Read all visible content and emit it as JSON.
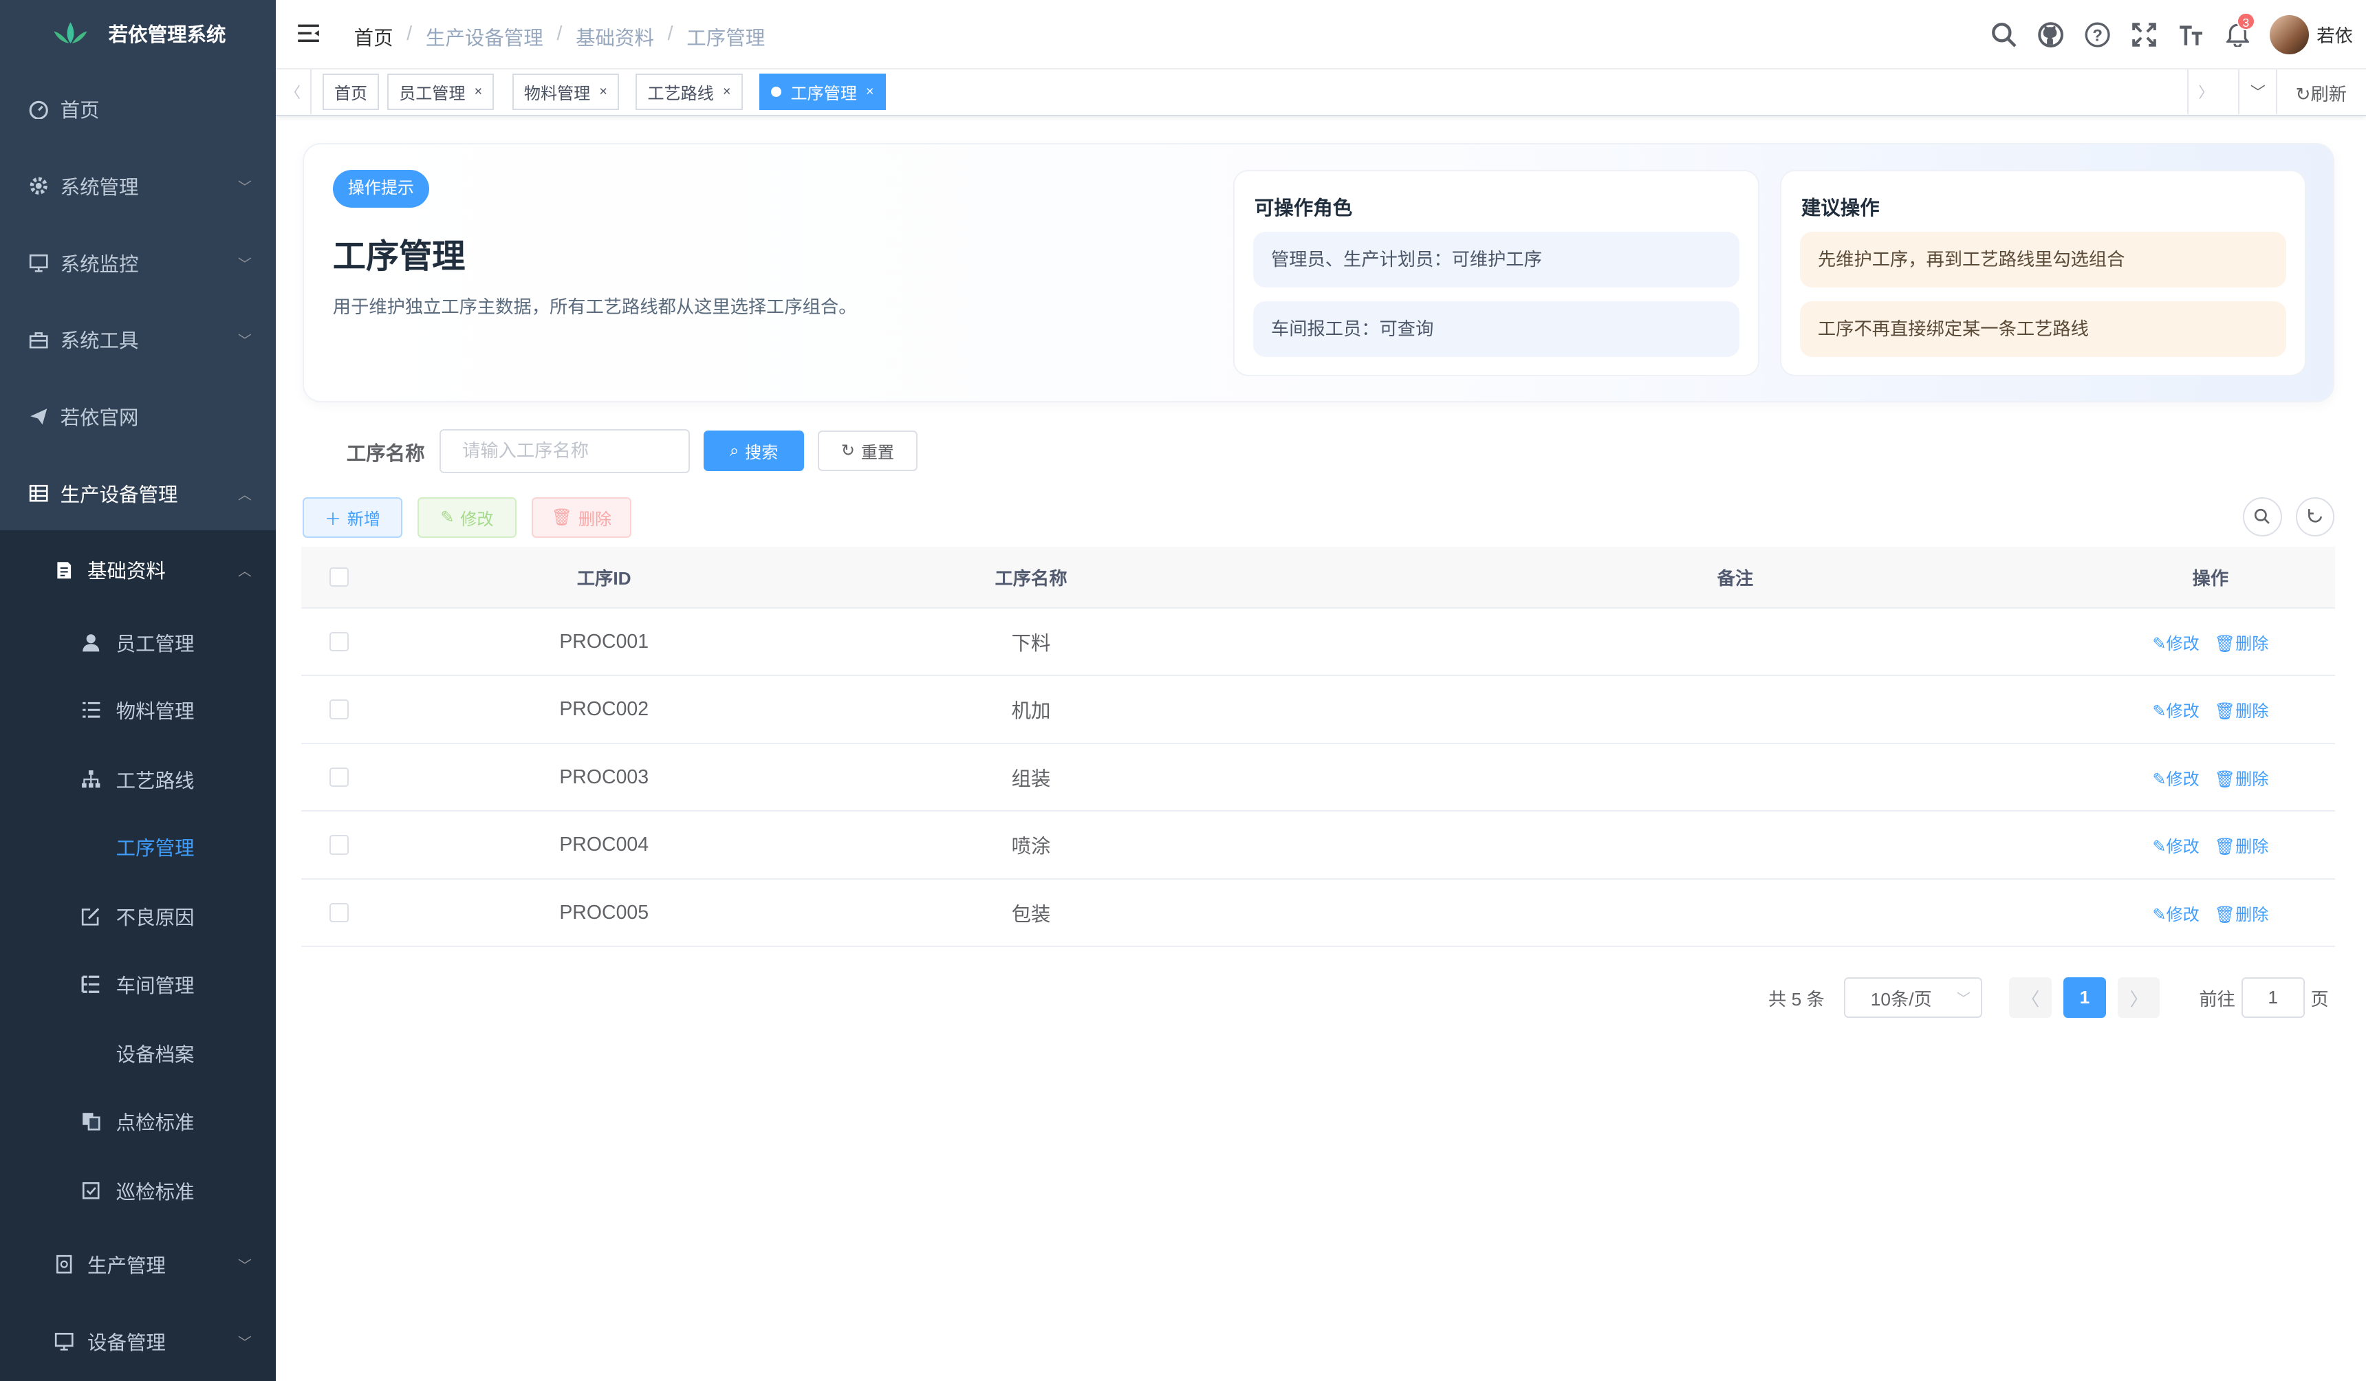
{
  "app": {
    "title": "若依管理系统"
  },
  "sidebar": {
    "items": [
      {
        "label": "首页"
      },
      {
        "label": "系统管理"
      },
      {
        "label": "系统监控"
      },
      {
        "label": "系统工具"
      },
      {
        "label": "若依官网"
      },
      {
        "label": "生产设备管理"
      }
    ],
    "sub": {
      "label": "基础资料"
    },
    "leaf": [
      {
        "label": "员工管理"
      },
      {
        "label": "物料管理"
      },
      {
        "label": "工艺路线"
      },
      {
        "label": "工序管理"
      },
      {
        "label": "不良原因"
      },
      {
        "label": "车间管理"
      },
      {
        "label": "设备档案"
      },
      {
        "label": "点检标准"
      },
      {
        "label": "巡检标准"
      }
    ],
    "tail": [
      {
        "label": "生产管理"
      },
      {
        "label": "设备管理"
      }
    ]
  },
  "breadcrumb": [
    "首页",
    "生产设备管理",
    "基础资料",
    "工序管理"
  ],
  "navbar": {
    "notif_count": "3",
    "username": "若依"
  },
  "tags": [
    {
      "label": "首页"
    },
    {
      "label": "员工管理"
    },
    {
      "label": "物料管理"
    },
    {
      "label": "工艺路线"
    },
    {
      "label": "工序管理"
    }
  ],
  "tags_refresh": "刷新",
  "hero": {
    "tag": "操作提示",
    "title": "工序管理",
    "desc": "用于维护独立工序主数据，所有工艺路线都从这里选择工序组合。",
    "roles_title": "可操作角色",
    "roles": [
      "管理员、生产计划员：可维护工序",
      "车间报工员：可查询"
    ],
    "suggest_title": "建议操作",
    "suggest": [
      "先维护工序，再到工艺路线里勾选组合",
      "工序不再直接绑定某一条工艺路线"
    ]
  },
  "search": {
    "label": "工序名称",
    "placeholder": "请输入工序名称",
    "search_btn": "搜索",
    "reset_btn": "重置"
  },
  "toolbar": {
    "add": "新增",
    "edit": "修改",
    "del": "删除"
  },
  "table": {
    "headers": [
      "工序ID",
      "工序名称",
      "备注",
      "操作"
    ],
    "rows": [
      {
        "id": "PROC001",
        "name": "下料",
        "remark": ""
      },
      {
        "id": "PROC002",
        "name": "机加",
        "remark": ""
      },
      {
        "id": "PROC003",
        "name": "组装",
        "remark": ""
      },
      {
        "id": "PROC004",
        "name": "喷涂",
        "remark": ""
      },
      {
        "id": "PROC005",
        "name": "包装",
        "remark": ""
      }
    ],
    "op_edit": "修改",
    "op_del": "删除"
  },
  "pagination": {
    "total": "共 5 条",
    "size": "10条/页",
    "current": "1",
    "goto_prefix": "前往",
    "goto_value": "1",
    "goto_suffix": "页"
  },
  "colors": {
    "sidebar": "#304156",
    "sidebar_sub": "#1f2d3d",
    "primary": "#409eff",
    "badge": "#f56c6c"
  }
}
